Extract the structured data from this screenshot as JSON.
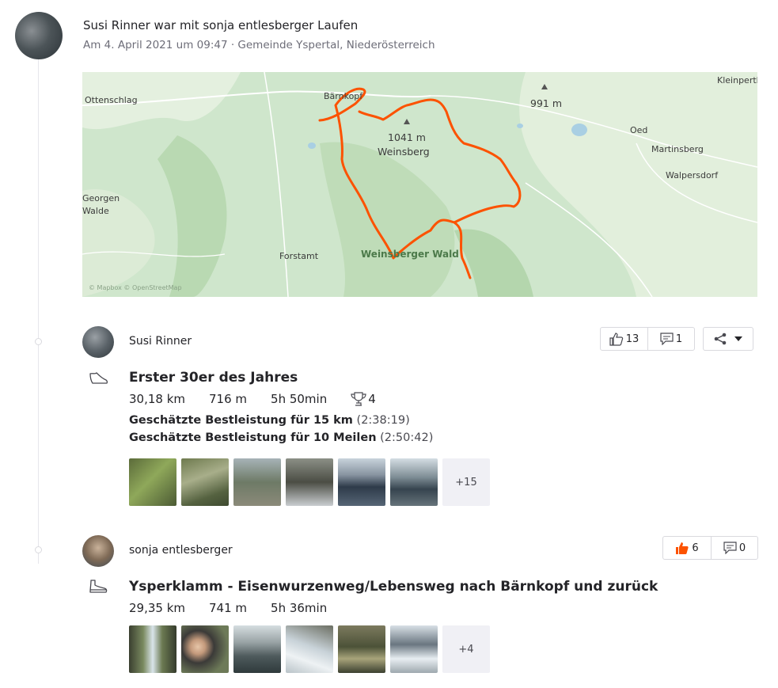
{
  "header": {
    "title": "Susi Rinner war mit sonja entlesberger Laufen",
    "meta": "Am 4. April 2021 um 09:47 · Gemeinde Yspertal, Niederösterreich"
  },
  "map": {
    "labels": {
      "ottenschlag": "Ottenschlag",
      "baernkopf": "Bärnkopf",
      "peak1041": "1041 m",
      "weinsberg": "Weinsberg",
      "peak991": "991 m",
      "kleinperth": "Kleinperth",
      "oed": "Oed",
      "martinsberg": "Martinsberg",
      "walpersdorf": "Walpersdorf",
      "georgen": "Georgen",
      "walde": "Walde",
      "forstamt": "Forstamt",
      "weinsberger_wald": "Weinsberger Wald"
    },
    "attribution": "© Mapbox © OpenStreetMap",
    "route_color": "#fc5200"
  },
  "entries": [
    {
      "athlete": "Susi Rinner",
      "title": "Erster 30er des Jahres",
      "sport_icon": "run-shoe-icon",
      "stats": {
        "distance": "30,18 km",
        "elevation": "716 m",
        "time": "5h 50min",
        "achievements": "4"
      },
      "best_efforts": [
        {
          "label": "Geschätzte Bestleistung für 15 km",
          "time": "(2:38:19)"
        },
        {
          "label": "Geschätzte Bestleistung für 10 Meilen",
          "time": "(2:50:42)"
        }
      ],
      "kudos": "13",
      "comments": "1",
      "more_photos": "+15"
    },
    {
      "athlete": "sonja entlesberger",
      "title": "Ysperklamm - Eisenwurzenweg/Lebensweg nach Bärnkopf und zurück",
      "sport_icon": "hike-boot-icon",
      "stats": {
        "distance": "29,35 km",
        "elevation": "741 m",
        "time": "5h 36min"
      },
      "kudos": "6",
      "comments": "0",
      "more_photos": "+4"
    }
  ],
  "colors": {
    "accent": "#fc5200",
    "text": "#242428",
    "muted": "#6d6d78"
  }
}
